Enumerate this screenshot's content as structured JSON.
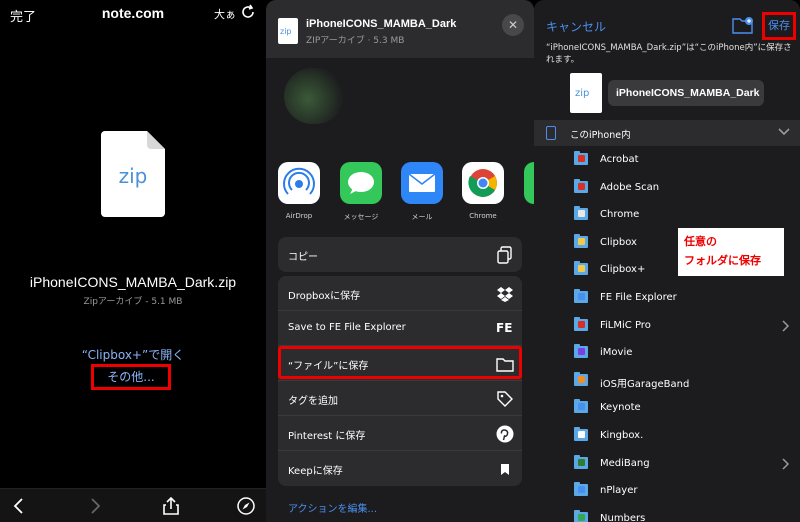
{
  "browser": {
    "done": "完了",
    "url": "note.com",
    "text_size": "大ぁ",
    "file_name": "iPhoneICONS_MAMBA_Dark.zip",
    "file_sub": "Zipアーカイブ - 5.1 MB",
    "file_icon_text": "zip",
    "open_in": "“Clipbox+”で開く",
    "other": "その他..."
  },
  "share_sheet": {
    "title": "iPhoneICONS_MAMBA_Dark",
    "subtitle": "ZIPアーカイブ · 5.3 MB",
    "icon_text": "zip",
    "close": "✕",
    "apps": [
      {
        "label": "AirDrop"
      },
      {
        "label": "メッセージ"
      },
      {
        "label": "メール"
      },
      {
        "label": "Chrome"
      }
    ],
    "copy": "コピー",
    "actions": [
      {
        "label": "Dropboxに保存"
      },
      {
        "label": "Save to FE File Explorer"
      },
      {
        "label": "“ファイル”に保存"
      },
      {
        "label": "タグを追加"
      },
      {
        "label": "Pinterest に保存"
      },
      {
        "label": "Keepに保存"
      }
    ],
    "fe_mark": "FE",
    "edit_actions": "アクションを編集..."
  },
  "save_dialog": {
    "cancel": "キャンセル",
    "save": "保存",
    "message": "“iPhoneICONS_MAMBA_Dark.zip”は“このiPhone内”に保存されます。",
    "thumb_text": "zip",
    "file_name": "iPhoneICONS_MAMBA_Dark",
    "location": "このiPhone内",
    "folders": [
      {
        "label": "Acrobat",
        "badge": "#d93025"
      },
      {
        "label": "Adobe Scan",
        "badge": "#d93025"
      },
      {
        "label": "Chrome",
        "badge": "#e8e8e8"
      },
      {
        "label": "Clipbox",
        "badge": "#f2c94c"
      },
      {
        "label": "Clipbox+",
        "badge": "#f2c94c"
      },
      {
        "label": "FE File Explorer",
        "badge": "#4a8ff0"
      },
      {
        "label": "FiLMiC Pro",
        "badge": "#d93025",
        "chevron": true
      },
      {
        "label": "iMovie",
        "badge": "#7b3fe4"
      },
      {
        "label": "iOS用GarageBand",
        "badge": "#f28c28"
      },
      {
        "label": "Keynote",
        "badge": "#4a8ff0"
      },
      {
        "label": "Kingbox.",
        "badge": "#ffffff"
      },
      {
        "label": "MediBang",
        "badge": "#2e7d32",
        "chevron": true
      },
      {
        "label": "nPlayer",
        "badge": "#4a8ff0"
      },
      {
        "label": "Numbers",
        "badge": "#34a853"
      }
    ],
    "annotation_line1": "任意の",
    "annotation_line2": "フォルダに保存"
  }
}
